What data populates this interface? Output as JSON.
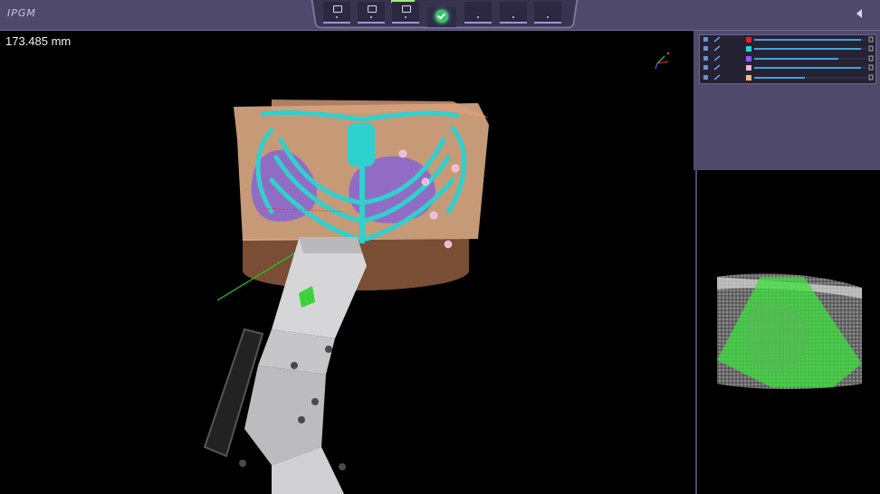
{
  "app": {
    "logo_text": "IPGM"
  },
  "toolbar": {
    "steps": [
      {
        "name": "step-1",
        "state": "done"
      },
      {
        "name": "step-2",
        "state": "done"
      },
      {
        "name": "step-3",
        "state": "done"
      },
      {
        "name": "step-4",
        "state": "current"
      },
      {
        "name": "step-5",
        "state": "todo"
      },
      {
        "name": "step-6",
        "state": "todo"
      },
      {
        "name": "step-7",
        "state": "todo"
      }
    ],
    "collapse_icon": "chevron-left-icon"
  },
  "viewport": {
    "distance_readout": "173.485 mm"
  },
  "segments": [
    {
      "color": "#e02222",
      "opacity": 0.95
    },
    {
      "color": "#24d6d6",
      "opacity": 0.95
    },
    {
      "color": "#8a5cf0",
      "opacity": 0.75
    },
    {
      "color": "#f2b6d8",
      "opacity": 0.95
    },
    {
      "color": "#f4b88a",
      "opacity": 0.45
    }
  ],
  "colors": {
    "panel_bg": "#4f4a6c",
    "bone": "#2fd1cf",
    "skin": "#e9b58c",
    "lung": "#7a58e6",
    "scan_overlay": "#3ee03e"
  }
}
